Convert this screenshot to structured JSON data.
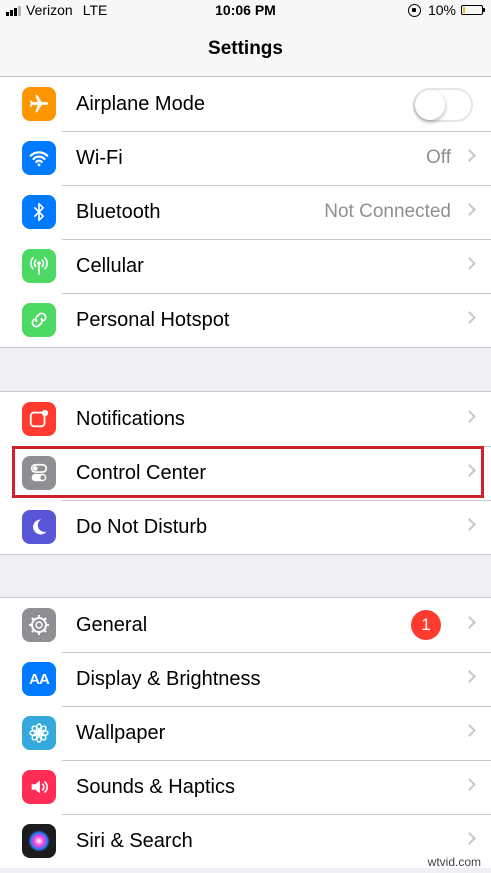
{
  "status_bar": {
    "carrier": "Verizon",
    "network": "LTE",
    "time": "10:06 PM",
    "battery": "10%",
    "battery_fraction": 0.1
  },
  "nav": {
    "title": "Settings"
  },
  "groups": [
    {
      "rows": [
        {
          "label": "Airplane Mode",
          "icon": "airplane-icon",
          "icon_color": "#ff9500",
          "control": "toggle",
          "toggle_on": false
        },
        {
          "label": "Wi-Fi",
          "icon": "wifi-icon",
          "icon_color": "#007aff",
          "value": "Off"
        },
        {
          "label": "Bluetooth",
          "icon": "bluetooth-icon",
          "icon_color": "#007aff",
          "value": "Not Connected"
        },
        {
          "label": "Cellular",
          "icon": "cellular-icon",
          "icon_color": "#4cd964"
        },
        {
          "label": "Personal Hotspot",
          "icon": "hotspot-icon",
          "icon_color": "#4cd964"
        }
      ]
    },
    {
      "rows": [
        {
          "label": "Notifications",
          "icon": "notifications-icon",
          "icon_color": "#ff3b30"
        },
        {
          "label": "Control Center",
          "icon": "control-center-icon",
          "icon_color": "#8e8e93",
          "highlighted": true,
          "highlight_color": "#d0202a"
        },
        {
          "label": "Do Not Disturb",
          "icon": "moon-icon",
          "icon_color": "#5856d6"
        }
      ]
    },
    {
      "rows": [
        {
          "label": "General",
          "icon": "gear-icon",
          "icon_color": "#8e8e93",
          "badge": "1"
        },
        {
          "label": "Display & Brightness",
          "icon": "display-icon",
          "icon_color": "#007aff",
          "icon_text": "AA"
        },
        {
          "label": "Wallpaper",
          "icon": "wallpaper-icon",
          "icon_color": "#34aadc"
        },
        {
          "label": "Sounds & Haptics",
          "icon": "sounds-icon",
          "icon_color": "#ff2d55"
        },
        {
          "label": "Siri & Search",
          "icon": "siri-icon",
          "icon_color": "#1c1c1e"
        }
      ]
    }
  ],
  "watermark": "wtvid.com"
}
